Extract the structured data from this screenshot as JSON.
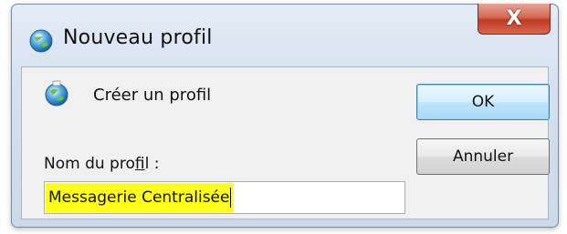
{
  "window": {
    "title": "Nouveau profil",
    "close_label": "X"
  },
  "dialog": {
    "heading": "Créer un profil",
    "name_label_pre": "Nom du pro",
    "name_label_mnemonic": "f",
    "name_label_post": "il :",
    "name_value": "Messagerie Centralisée",
    "ok_label": "OK",
    "cancel_label": "Annuler"
  },
  "colors": {
    "highlight": "#ffff1a",
    "close_button": "#c9472f",
    "ok_border": "#3c7fb1"
  },
  "icons": {
    "app": "profile-globe-icon",
    "heading": "profile-globe-icon",
    "close": "close-icon"
  }
}
